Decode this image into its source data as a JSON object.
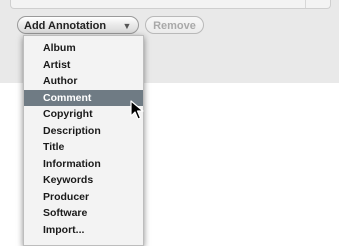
{
  "toolbar": {
    "add_annotation_label": "Add Annotation",
    "add_annotation_arrow": "▼",
    "remove_label": "Remove"
  },
  "menu": {
    "items": [
      {
        "label": "Album"
      },
      {
        "label": "Artist"
      },
      {
        "label": "Author"
      },
      {
        "label": "Comment",
        "highlighted": true
      },
      {
        "label": "Copyright"
      },
      {
        "label": "Description"
      },
      {
        "label": "Title"
      },
      {
        "label": "Information"
      },
      {
        "label": "Keywords"
      },
      {
        "label": "Producer"
      },
      {
        "label": "Software"
      },
      {
        "label": "Import..."
      }
    ]
  },
  "colors": {
    "menu_highlight": "#6f7b84",
    "panel_background": "#e9e9e9"
  },
  "icons": {
    "cursor": "arrow-cursor-icon",
    "dropdown": "chevron-down-icon"
  }
}
